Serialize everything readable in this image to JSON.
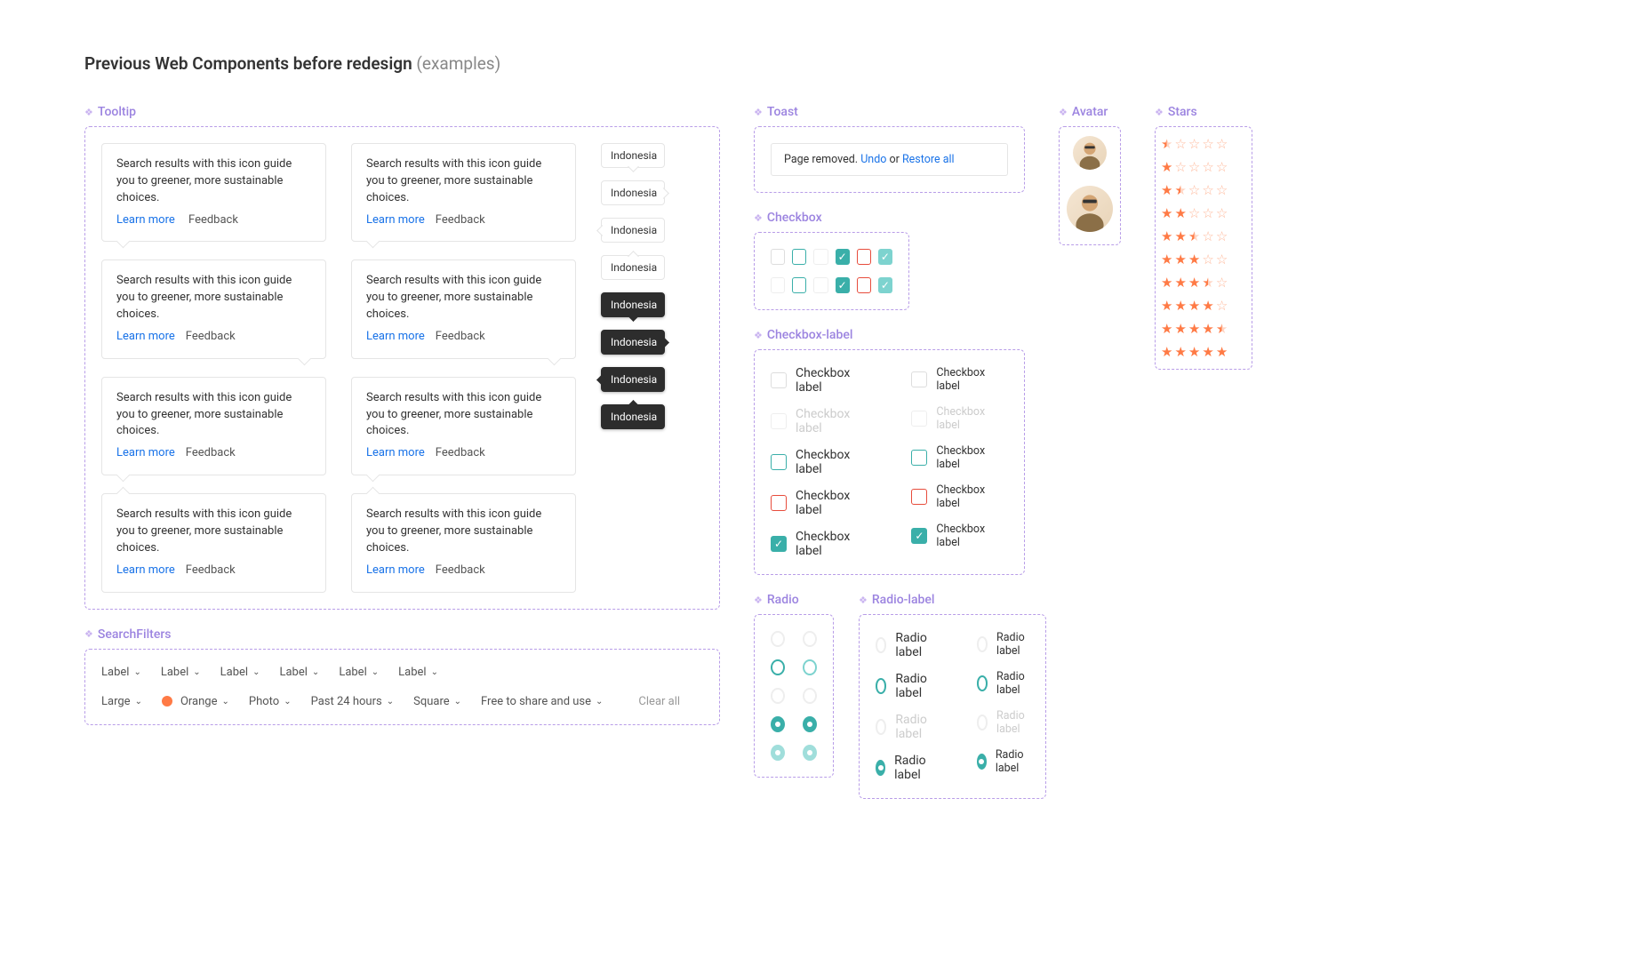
{
  "page_title": "Previous Web Components before redesign",
  "page_title_sub": "(examples)",
  "sections": {
    "tooltip": "Tooltip",
    "search_filters": "SearchFilters",
    "toast": "Toast",
    "checkbox": "Checkbox",
    "checkbox_label": "Checkbox-label",
    "avatar": "Avatar",
    "stars": "Stars",
    "radio": "Radio",
    "radio_label": "Radio-label"
  },
  "tooltip": {
    "body": "Search results with this icon guide you to greener, more sustainable choices.",
    "learn_more": "Learn more",
    "feedback": "Feedback",
    "mini_label": "Indonesia"
  },
  "toast_msg": {
    "text": "Page removed.",
    "undo": "Undo",
    "or": "or",
    "restore": "Restore all"
  },
  "checkbox_label_text": "Checkbox label",
  "radio_label_text": "Radio label",
  "filters_row1": [
    "Label",
    "Label",
    "Label",
    "Label",
    "Label",
    "Label"
  ],
  "filters_row2": [
    "Large",
    "Orange",
    "Photo",
    "Past 24 hours",
    "Square",
    "Free to share and use"
  ],
  "clear_all": "Clear all",
  "stars": [
    0.5,
    1,
    1.5,
    2,
    2.5,
    3,
    3.5,
    4,
    4.5,
    5
  ]
}
